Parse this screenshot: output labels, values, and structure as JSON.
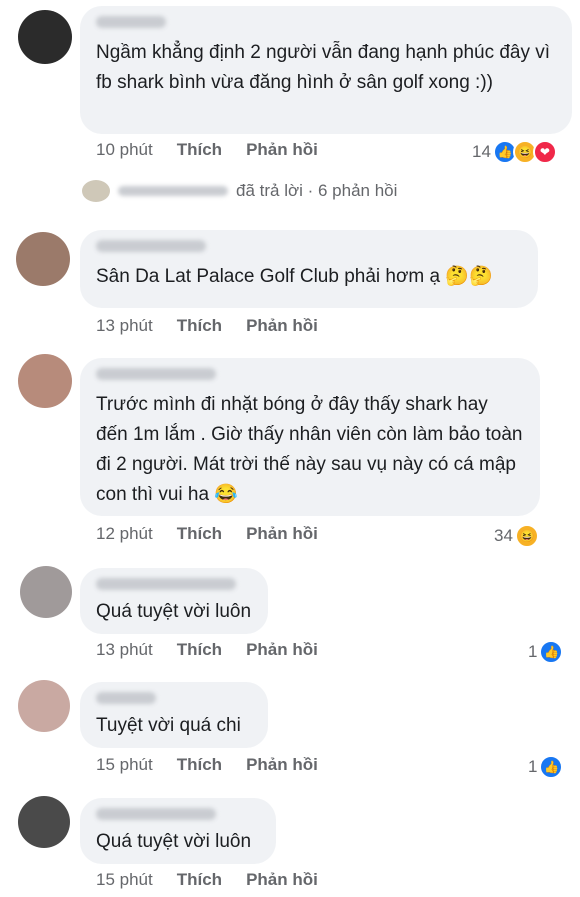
{
  "comments": [
    {
      "text": "Ngầm khẳng định 2 người vẫn đang hạnh phúc đây vì fb shark bình vừa đăng hình ở sân golf xong :))",
      "time": "10 phút",
      "like": "Thích",
      "reply": "Phản hồi",
      "reaction_count": "14"
    },
    {
      "text": "Sân Da Lat Palace Golf Club phải hơm ạ",
      "emoji": "🤔🤔",
      "time": "13 phút",
      "like": "Thích",
      "reply": "Phản hồi"
    },
    {
      "text": "Trước mình đi nhặt bóng ở đây thấy shark hay đến 1m lắm . Giờ thấy nhân viên còn làm bảo toàn đi 2 người. Mát trời thế này sau vụ này có cá mập con thì vui ha",
      "emoji": "😂",
      "time": "12 phút",
      "like": "Thích",
      "reply": "Phản hồi",
      "reaction_count": "34"
    },
    {
      "text": "Quá tuyệt vời luôn",
      "time": "13 phút",
      "like": "Thích",
      "reply": "Phản hồi",
      "reaction_count": "1"
    },
    {
      "text": "Tuyệt vời quá chi",
      "time": "15 phút",
      "like": "Thích",
      "reply": "Phản hồi",
      "reaction_count": "1"
    },
    {
      "text": "Quá tuyệt vời luôn",
      "time": "15 phút",
      "like": "Thích",
      "reply": "Phản hồi"
    }
  ],
  "replies_summary": "đã trả lời · 6 phản hồi",
  "icons": {
    "like": "like-icon",
    "haha": "haha-icon",
    "love": "love-icon"
  },
  "colors": {
    "bubble": "#f0f2f5",
    "like": "#1877f2",
    "meta": "#65676b"
  }
}
